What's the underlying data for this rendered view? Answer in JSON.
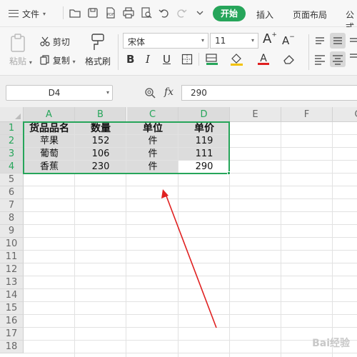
{
  "menubar": {
    "file_label": "文件",
    "tabs": [
      {
        "label": "开始",
        "active": true
      },
      {
        "label": "插入"
      },
      {
        "label": "页面布局"
      },
      {
        "label": "公式"
      }
    ]
  },
  "ribbon": {
    "paste_label": "粘贴",
    "cut_label": "剪切",
    "copy_label": "复制",
    "format_painter_label": "格式刷",
    "font_name": "宋体",
    "font_size": "11",
    "bold": "B",
    "italic": "I",
    "underline": "U",
    "grow_font": "A",
    "shrink_font": "A"
  },
  "formula_bar": {
    "name_box": "D4",
    "fx_label": "fx",
    "formula_value": "290"
  },
  "sheet": {
    "columns": [
      "A",
      "B",
      "C",
      "D",
      "E",
      "F",
      "G"
    ],
    "rows": [
      "1",
      "2",
      "3",
      "4",
      "5",
      "6",
      "7",
      "8",
      "9",
      "10",
      "11",
      "12",
      "13",
      "14",
      "15",
      "16",
      "17",
      "18"
    ],
    "cells": [
      [
        "货品品名",
        "数量",
        "单位",
        "单价"
      ],
      [
        "苹果",
        "152",
        "件",
        "119"
      ],
      [
        "葡萄",
        "106",
        "件",
        "111"
      ],
      [
        "香蕉",
        "230",
        "件",
        "290"
      ]
    ]
  },
  "watermark": "Bai经验",
  "colors": {
    "accent": "#26a55a",
    "arrow": "#e02020",
    "selection_fill": "#dcdcdc"
  }
}
